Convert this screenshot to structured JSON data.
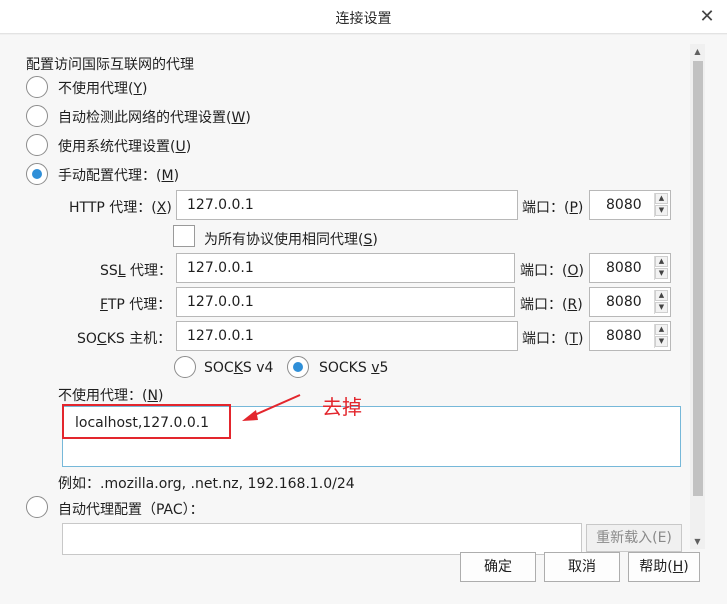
{
  "window": {
    "title": "连接设置",
    "close_glyph": "✕"
  },
  "section_heading": "配置访问国际互联网的代理",
  "proxy_modes": [
    {
      "label": "不使用代理(",
      "key": "Y",
      "suffix": ")",
      "checked": false
    },
    {
      "label": "自动检测此网络的代理设置(",
      "key": "W",
      "suffix": ")",
      "checked": false
    },
    {
      "label": "使用系统代理设置(",
      "key": "U",
      "suffix": ")",
      "checked": false
    },
    {
      "label": "手动配置代理：(",
      "key": "M",
      "suffix": ")",
      "checked": true
    }
  ],
  "http": {
    "label_pre": "HTTP 代理：(",
    "key": "X",
    "label_post": ")",
    "value": "127.0.0.1",
    "port_label_pre": "端口：(",
    "port_key": "P",
    "port_label_post": ")",
    "port": "8080"
  },
  "same_proxy": {
    "label_pre": "为所有协议使用相同代理(",
    "key": "S",
    "label_post": ")",
    "checked": false
  },
  "ssl": {
    "label_pre": "SS",
    "key": "L",
    "label_post": " 代理：",
    "value": "127.0.0.1",
    "port_label_pre": "端口：(",
    "port_key": "O",
    "port_label_post": ")",
    "port": "8080"
  },
  "ftp": {
    "label_pre": "",
    "key": "F",
    "label_post": "TP 代理：",
    "value": "127.0.0.1",
    "port_label_pre": "端口：(",
    "port_key": "R",
    "port_label_post": ")",
    "port": "8080"
  },
  "socks": {
    "label_pre": "SO",
    "key": "C",
    "label_post": "KS 主机：",
    "value": "127.0.0.1",
    "port_label_pre": "端口：(",
    "port_key": "T",
    "port_label_post": ")",
    "port": "8080"
  },
  "socks_versions": [
    {
      "label_pre": "SOC",
      "key": "K",
      "label_post": "S v4",
      "checked": false
    },
    {
      "label_pre": "SOCKS ",
      "key": "v",
      "label_post": "5",
      "checked": true
    }
  ],
  "no_proxy": {
    "label_pre": "不使用代理：(",
    "key": "N",
    "label_post": ")",
    "value": "localhost,127.0.0.1",
    "example": "例如：.mozilla.org, .net.nz, 192.168.1.0/24"
  },
  "annotation": {
    "text": "去掉",
    "color": "#e3262d"
  },
  "pac": {
    "label": "自动代理配置（PAC）：",
    "reload_label": "重新载入(E)",
    "checked": false
  },
  "buttons": {
    "ok": "确定",
    "cancel": "取消",
    "help_pre": "帮助(",
    "help_key": "H",
    "help_post": ")"
  },
  "colors": {
    "accent": "#2f8fd8",
    "annotation_red": "#e3262d",
    "focus_border": "#76b8d9"
  }
}
